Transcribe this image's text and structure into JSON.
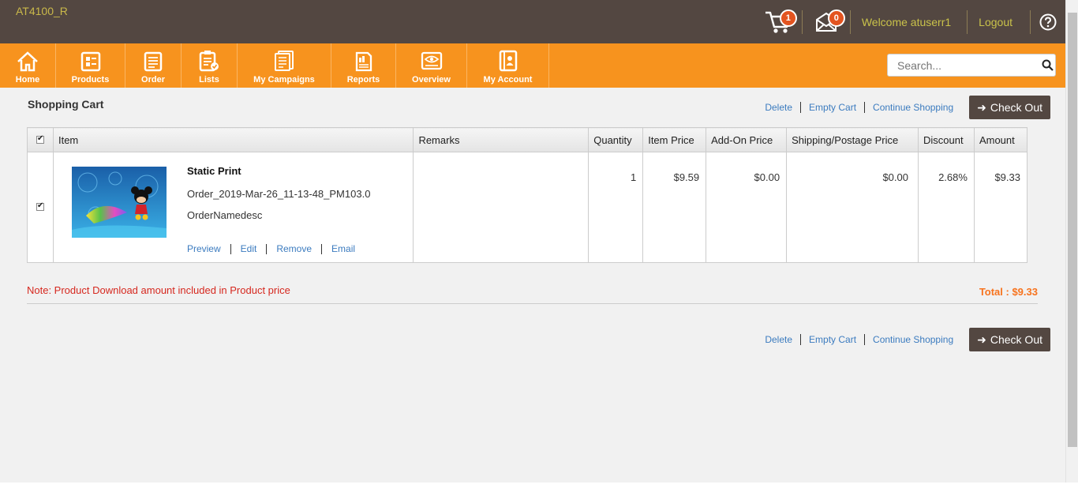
{
  "header": {
    "brand": "AT4100_R",
    "cart_count": "1",
    "message_count": "0",
    "welcome": "Welcome atuserr1",
    "logout": "Logout",
    "help_icon": "question-circle-icon"
  },
  "nav": {
    "items": [
      {
        "label": "Home",
        "icon": "home-icon"
      },
      {
        "label": "Products",
        "icon": "products-icon"
      },
      {
        "label": "Order",
        "icon": "order-icon"
      },
      {
        "label": "Lists",
        "icon": "lists-icon"
      },
      {
        "label": "My Campaigns",
        "icon": "campaigns-icon"
      },
      {
        "label": "Reports",
        "icon": "reports-icon"
      },
      {
        "label": "Overview",
        "icon": "overview-icon"
      },
      {
        "label": "My Account",
        "icon": "account-icon"
      }
    ],
    "search_placeholder": "Search..."
  },
  "page": {
    "title": "Shopping Cart",
    "actions": {
      "delete": "Delete",
      "empty_cart": "Empty Cart",
      "continue_shopping": "Continue Shopping",
      "checkout": "Check Out"
    }
  },
  "table": {
    "headers": [
      "Item",
      "Remarks",
      "Quantity",
      "Item Price",
      "Add-On Price",
      "Shipping/Postage Price",
      "Discount",
      "Amount"
    ],
    "rows": [
      {
        "name": "Static Print",
        "order": "Order_2019-Mar-26_11-13-48_PM103.0",
        "description": "OrderNamedesc",
        "remarks": "",
        "quantity": "1",
        "item_price": "$9.59",
        "addon_price": "$0.00",
        "shipping_price": "$0.00",
        "discount": "2.68%",
        "amount": "$9.33",
        "links": {
          "preview": "Preview",
          "edit": "Edit",
          "remove": "Remove",
          "email": "Email"
        }
      }
    ]
  },
  "note": "Note: Product Download amount included in Product price",
  "total": "Total : $9.33",
  "colors": {
    "topbar": "#534741",
    "navbar": "#f7931e",
    "link": "#3b7bbf",
    "note": "#d6281f",
    "total": "#f7731e"
  }
}
